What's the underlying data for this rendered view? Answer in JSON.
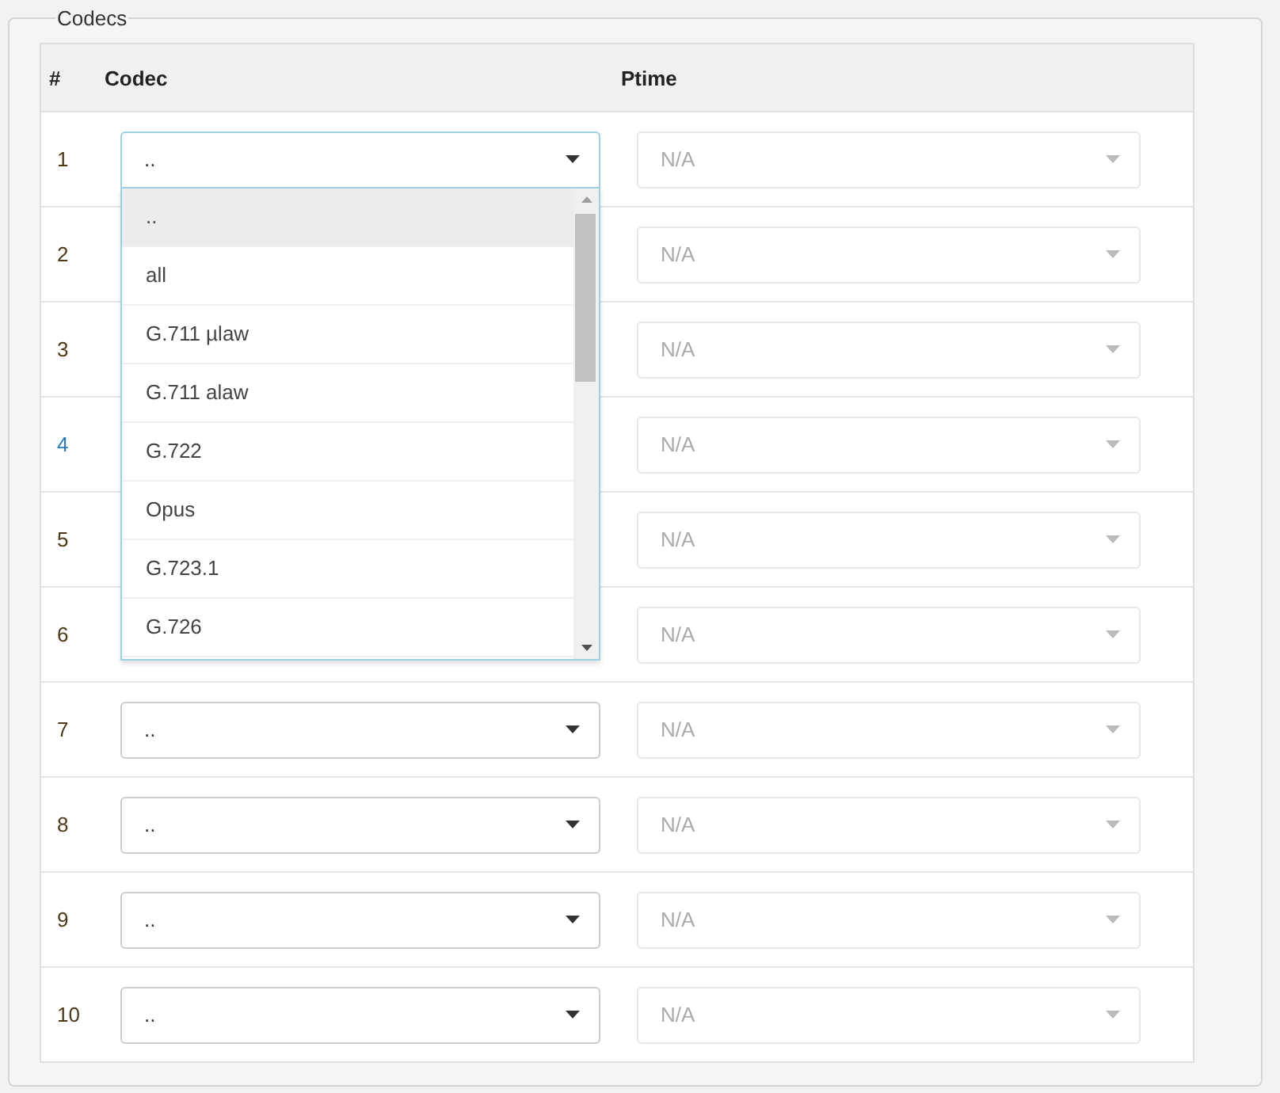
{
  "fieldset": {
    "legend": "Codecs"
  },
  "table": {
    "columns": [
      "#",
      "Codec",
      "Ptime"
    ],
    "rows": [
      {
        "number": "1",
        "color": "#4a3a1a",
        "codec": "..",
        "open": true,
        "ptime": "N/A"
      },
      {
        "number": "2",
        "color": "#4a3a1a",
        "ptime": "N/A"
      },
      {
        "number": "3",
        "color": "#4a3a1a",
        "ptime": "N/A"
      },
      {
        "number": "4",
        "color": "#2a7ab8",
        "ptime": "N/A"
      },
      {
        "number": "5",
        "color": "#4a3a1a",
        "ptime": "N/A"
      },
      {
        "number": "6",
        "color": "#4a3a1a",
        "ptime": "N/A"
      },
      {
        "number": "7",
        "color": "#4a3a1a",
        "codec": "..",
        "open": false,
        "ptime": "N/A"
      },
      {
        "number": "8",
        "color": "#4a3a1a",
        "codec": "..",
        "open": false,
        "ptime": "N/A"
      },
      {
        "number": "9",
        "color": "#4a3a1a",
        "codec": "..",
        "open": false,
        "ptime": "N/A"
      },
      {
        "number": "10",
        "color": "#4a3a1a",
        "codec": "..",
        "open": false,
        "ptime": "N/A"
      }
    ]
  },
  "dropdown": {
    "options": [
      {
        "label": "..",
        "selected": true
      },
      {
        "label": "all",
        "selected": false
      },
      {
        "label": "G.711 µlaw",
        "selected": false
      },
      {
        "label": "G.711 alaw",
        "selected": false
      },
      {
        "label": "G.722",
        "selected": false
      },
      {
        "label": "Opus",
        "selected": false
      },
      {
        "label": "G.723.1",
        "selected": false
      },
      {
        "label": "G.726",
        "selected": false
      }
    ]
  }
}
